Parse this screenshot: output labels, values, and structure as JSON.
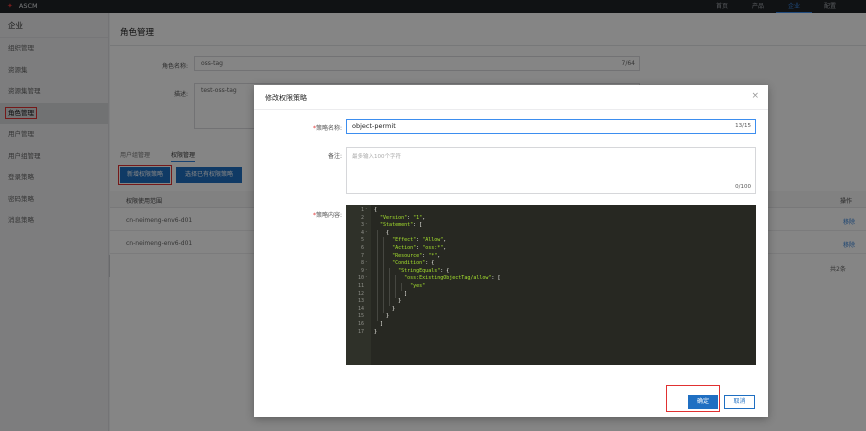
{
  "topbar": {
    "brand": "ASCM",
    "nav": [
      "首页",
      "产品",
      "企业",
      "配置"
    ],
    "active_index": 2
  },
  "sidebar": {
    "title": "企业",
    "items": [
      "组织管理",
      "资源集",
      "资源集管理",
      "角色管理",
      "用户管理",
      "用户组管理",
      "登录策略",
      "密码策略",
      "消息策略"
    ],
    "active_index": 3
  },
  "main": {
    "title": "角色管理",
    "role_name_label": "角色名称:",
    "role_name_value": "oss-tag",
    "role_name_count": "7/64",
    "desc_label": "描述:",
    "desc_value": "test-oss-tag",
    "tabs": [
      "用户组管理",
      "权限管理"
    ],
    "btn_add_policy": "新增权限策略",
    "btn_select_policy": "选择已有权限策略",
    "table_header_scope": "权限使用范围",
    "table_header_op": "操作",
    "rows": [
      {
        "scope": "cn-neimeng-env6-d01",
        "op": "移除"
      },
      {
        "scope": "cn-neimeng-env6-d01",
        "op": "移除"
      }
    ],
    "total_text": "共2条"
  },
  "modal": {
    "title": "修改权限策略",
    "policy_name_label": "策略名称:",
    "policy_name_value": "object-permit",
    "policy_name_count": "13/15",
    "remark_label": "备注:",
    "remark_placeholder": "最多输入100个字符",
    "remark_count": "0/100",
    "content_label": "策略内容:",
    "code_lines": [
      "{",
      "  \"Version\": \"1\",",
      "  \"Statement\": [",
      "    {",
      "      \"Effect\": \"Allow\",",
      "      \"Action\": \"oss:*\",",
      "      \"Resource\": \"*\",",
      "      \"Condition\": {",
      "        \"StringEquals\": {",
      "          \"oss:ExistingObjectTag/allow\": [",
      "            \"yes\"",
      "          ]",
      "        }",
      "      }",
      "    }",
      "  ]",
      "}"
    ],
    "ok_label": "确定",
    "cancel_label": "取消"
  },
  "colors": {
    "primary": "#1f6fc2",
    "highlight_red": "#e03131",
    "editor_bg": "#272822",
    "editor_string": "#a6e22e"
  }
}
